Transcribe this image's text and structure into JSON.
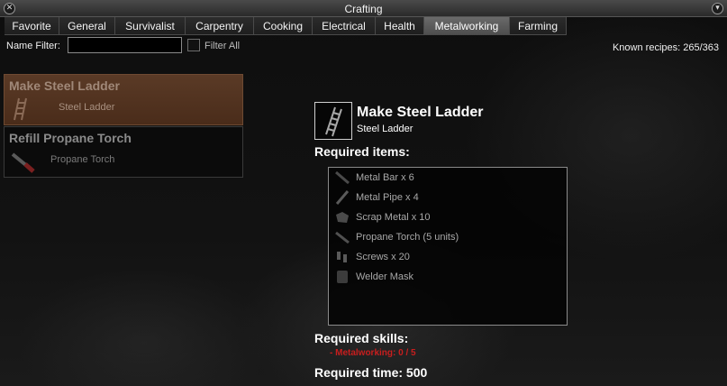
{
  "window": {
    "title": "Crafting"
  },
  "titlebar": {
    "close_glyph": "✕",
    "collapse_glyph": "▾"
  },
  "tabs": [
    {
      "label": "Favorite",
      "active": false
    },
    {
      "label": "General",
      "active": false
    },
    {
      "label": "Survivalist",
      "active": false
    },
    {
      "label": "Carpentry",
      "active": false
    },
    {
      "label": "Cooking",
      "active": false
    },
    {
      "label": "Electrical",
      "active": false
    },
    {
      "label": "Health",
      "active": false
    },
    {
      "label": "Metalworking",
      "active": true
    },
    {
      "label": "Farming",
      "active": false
    }
  ],
  "filter": {
    "name_label": "Name Filter:",
    "value": "",
    "filter_all_label": "Filter All",
    "filter_all_checked": false
  },
  "known_recipes": "Known recipes:  265/363",
  "recipes": [
    {
      "name": "Make Steel Ladder",
      "result": "Steel Ladder",
      "icon": "ladder-icon",
      "selected": true
    },
    {
      "name": "Refill Propane Torch",
      "result": "Propane Torch",
      "icon": "propane-torch-icon",
      "selected": false
    }
  ],
  "detail": {
    "name": "Make Steel Ladder",
    "result": "Steel Ladder",
    "icon": "ladder-icon",
    "required_items_label": "Required items:",
    "items": [
      {
        "label": "Metal Bar x 6",
        "icon": "metal-bar-icon"
      },
      {
        "label": "Metal Pipe x 4",
        "icon": "metal-pipe-icon"
      },
      {
        "label": "Scrap Metal x 10",
        "icon": "scrap-metal-icon"
      },
      {
        "label": "Propane Torch (5 units)",
        "icon": "propane-torch-icon"
      },
      {
        "label": "Screws x 20",
        "icon": "screws-icon"
      },
      {
        "label": "Welder Mask",
        "icon": "welder-mask-icon"
      }
    ],
    "required_skills_label": "Required skills:",
    "skills": [
      {
        "label": "- Metalworking: 0 / 5",
        "color": "#c81e1e"
      }
    ],
    "required_time": "Required time: 500"
  },
  "colors": {
    "selected_row": "#4a2c1a",
    "skill_missing": "#c81e1e",
    "active_tab": "#5a5a5a"
  }
}
